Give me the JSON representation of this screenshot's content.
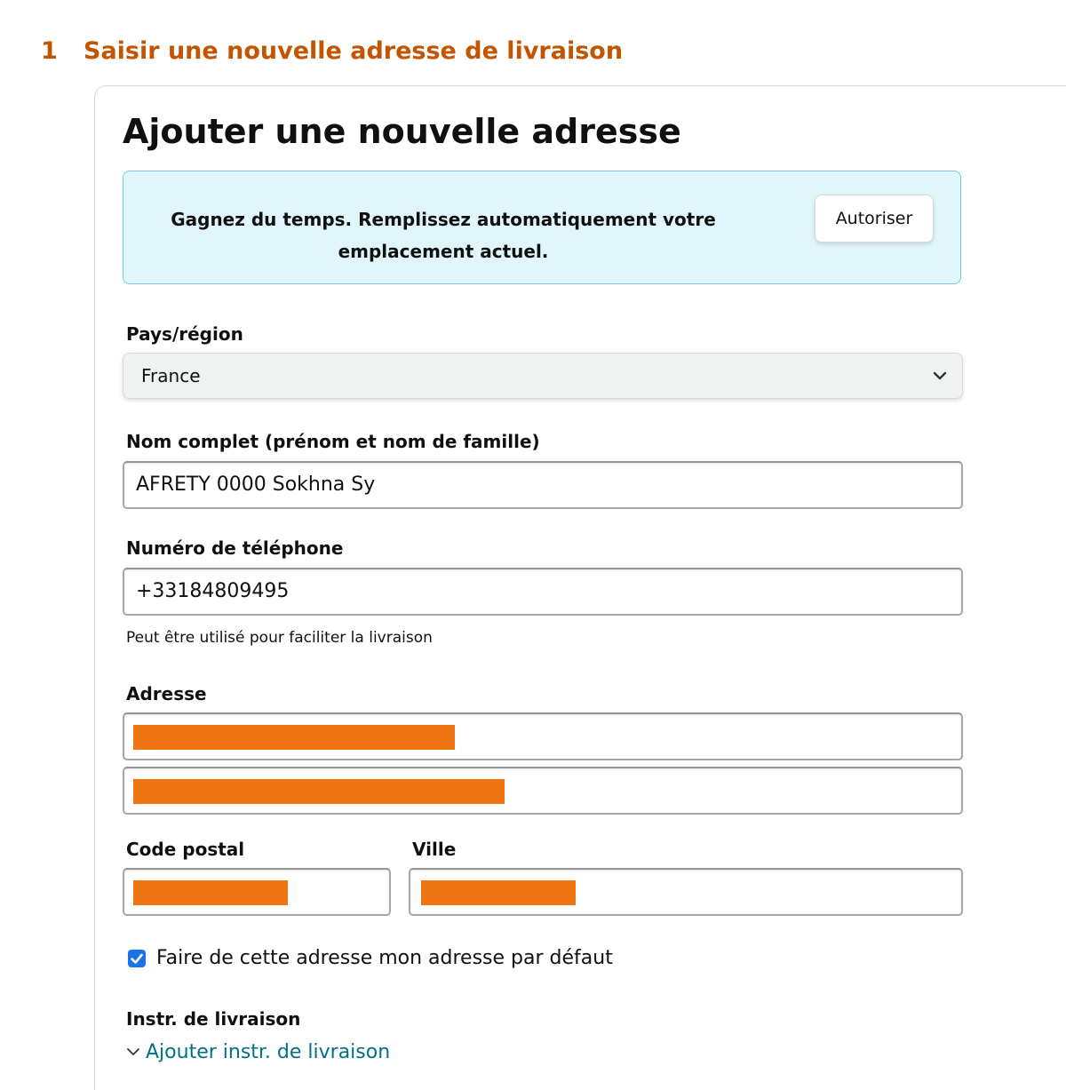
{
  "step": {
    "number": "1",
    "title": "Saisir une nouvelle adresse de livraison"
  },
  "card": {
    "title": "Ajouter une nouvelle adresse"
  },
  "autofill_banner": {
    "text": "Gagnez du temps. Remplissez automatiquement votre emplacement actuel.",
    "button_label": "Autoriser"
  },
  "form": {
    "country": {
      "label": "Pays/région",
      "value": "France"
    },
    "full_name": {
      "label": "Nom complet (prénom et nom de famille)",
      "value": "AFRETY 0000 Sokhna Sy"
    },
    "phone": {
      "label": "Numéro de téléphone",
      "value": "+33184809495",
      "hint": "Peut être utilisé pour faciliter la livraison"
    },
    "address": {
      "label": "Adresse"
    },
    "postal_code": {
      "label": "Code postal"
    },
    "city": {
      "label": "Ville"
    },
    "default_checkbox": {
      "label": "Faire de cette adresse mon adresse par défaut",
      "checked": true
    },
    "delivery_instructions": {
      "label": "Instr. de livraison",
      "link": "Ajouter instr. de livraison"
    }
  },
  "colors": {
    "step_title": "#c45500",
    "redaction": "#ee7511",
    "link": "#007185",
    "banner_bg": "#e0f6fb"
  },
  "icons": {
    "select": "chevron-down-icon",
    "link": "chevron-down-icon",
    "checkbox": "checkmark-icon"
  }
}
